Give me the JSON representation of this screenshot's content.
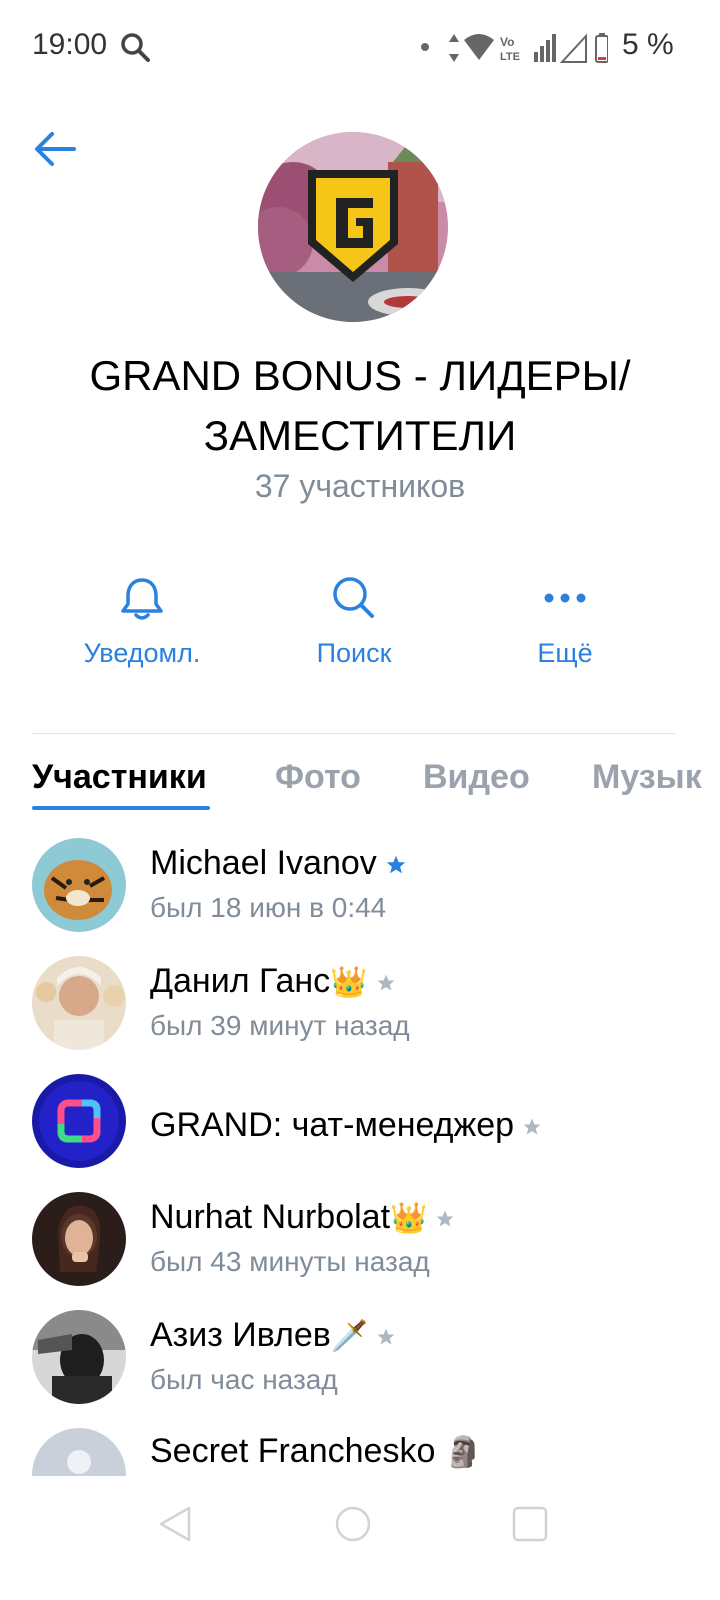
{
  "status_bar": {
    "time": "19:00",
    "battery": "5 %",
    "icons": [
      "search-icon",
      "dot-icon",
      "data-arrows-icon",
      "wifi-icon",
      "volte-icon",
      "signal-icon",
      "signal-empty-icon",
      "battery-low-icon"
    ]
  },
  "header": {
    "back_icon": "arrow-left-icon",
    "title": "GRAND BONUS - ЛИДЕРЫ/ ЗАМЕСТИТЕЛИ",
    "member_count": "37 участников"
  },
  "actions": [
    {
      "label": "Уведомл.",
      "icon": "bell-icon"
    },
    {
      "label": "Поиск",
      "icon": "search-icon"
    },
    {
      "label": "Ещё",
      "icon": "more-dots-icon"
    }
  ],
  "tabs": [
    {
      "label": "Участники",
      "active": true
    },
    {
      "label": "Фото",
      "active": false
    },
    {
      "label": "Видео",
      "active": false
    },
    {
      "label": "Музык",
      "active": false
    }
  ],
  "members": [
    {
      "name": "Michael Ivanov",
      "emoji": "",
      "status": "был 18 июн в 0:44",
      "star": "blue"
    },
    {
      "name": "Данил Ганс",
      "emoji": "👑",
      "status": "был 39 минут назад",
      "star": "gray"
    },
    {
      "name": "GRAND: чат-менеджер",
      "emoji": "",
      "status": "",
      "star": "gray"
    },
    {
      "name": "Nurhat Nurbolat",
      "emoji": "👑",
      "status": "был 43 минуты назад",
      "star": "gray"
    },
    {
      "name": "Азиз Ивлев",
      "emoji": "🗡️",
      "status": "был час назад",
      "star": "gray"
    },
    {
      "name": "Secret Franchesko",
      "emoji": "🗿",
      "status": "",
      "star": ""
    }
  ],
  "colors": {
    "accent": "#2a81e0",
    "secondary_text": "#818c99",
    "inactive_tab": "#99a2ad",
    "star_blue": "#2a81e0",
    "star_gray": "#aeb7c2"
  },
  "navbar": {
    "icons": [
      "nav-back-icon",
      "nav-home-icon",
      "nav-recents-icon"
    ]
  }
}
